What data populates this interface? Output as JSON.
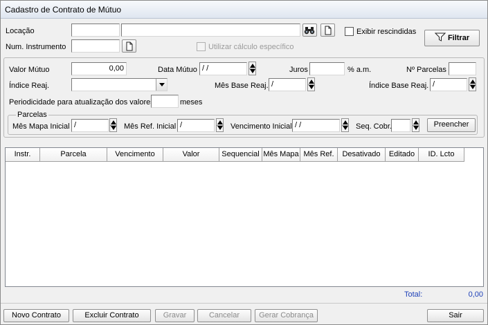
{
  "window": {
    "title": "Cadastro de Contrato de Mútuo"
  },
  "filters": {
    "locacao_label": "Locação",
    "locacao_code": "",
    "locacao_name": "",
    "num_instrumento_label": "Num. Instrumento",
    "num_instrumento_value": "",
    "exibir_rescindidas_label": "Exibir rescindidas",
    "utilizar_calculo_label": "Utilizar cálculo específico",
    "filtrar_label": "Filtrar"
  },
  "form": {
    "valor_mutuo_label": "Valor Mútuo",
    "valor_mutuo_value": "0,00",
    "data_mutuo_label": "Data Mútuo",
    "data_mutuo_value": " /  /",
    "juros_label": "Juros",
    "juros_value": "",
    "juros_unit": "% a.m.",
    "num_parcelas_label": "Nº Parcelas",
    "num_parcelas_value": "",
    "indice_reaj_label": "Índice Reaj.",
    "indice_reaj_value": "",
    "mes_base_reaj_label": "Mês Base Reaj.",
    "mes_base_reaj_value": "  /",
    "indice_base_reaj_label": "Índice Base Reaj.",
    "indice_base_reaj_value": "  /",
    "periodicidade_label": "Periodicidade para atualização dos valores",
    "periodicidade_value": "",
    "periodicidade_unit": "meses"
  },
  "parcelas": {
    "group_label": "Parcelas",
    "mes_mapa_inicial_label": "Mês Mapa Inicial",
    "mes_mapa_inicial_value": "  /",
    "mes_ref_inicial_label": "Mês Ref. Inicial",
    "mes_ref_inicial_value": "  /",
    "vencimento_inicial_label": "Vencimento Inicial",
    "vencimento_inicial_value": " /  /",
    "seq_cobr_label": "Seq. Cobr.",
    "seq_cobr_value": "",
    "preencher_label": "Preencher"
  },
  "grid": {
    "columns": [
      "Instr.",
      "Parcela",
      "Vencimento",
      "Valor",
      "Sequencial",
      "Mês Mapa",
      "Mês Ref.",
      "Desativado",
      "Editado",
      "ID. Lcto"
    ]
  },
  "totals": {
    "label": "Total:",
    "value": "0,00",
    "color": "#1c3fb8"
  },
  "footer": {
    "novo_contrato": "Novo Contrato",
    "excluir_contrato": "Excluir Contrato",
    "gravar": "Gravar",
    "cancelar": "Cancelar",
    "gerar_cobranca": "Gerar Cobrança",
    "sair": "Sair"
  }
}
